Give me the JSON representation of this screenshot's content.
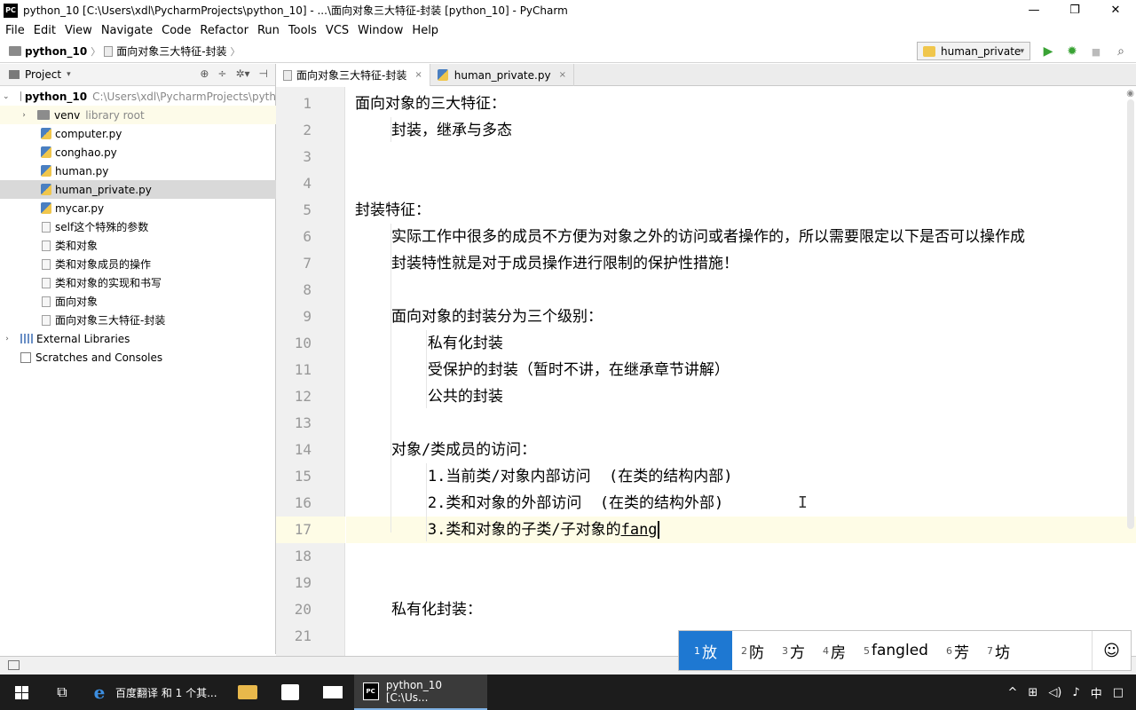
{
  "window": {
    "title": "python_10 [C:\\Users\\xdl\\PycharmProjects\\python_10] - ...\\面向对象三大特征-封装 [python_10] - PyCharm",
    "logo": "PC",
    "minimize": "—",
    "restore": "❐",
    "close": "✕"
  },
  "menu": [
    "File",
    "Edit",
    "View",
    "Navigate",
    "Code",
    "Refactor",
    "Run",
    "Tools",
    "VCS",
    "Window",
    "Help"
  ],
  "breadcrumb": {
    "project": "python_10",
    "file": "面向对象三大特征-封装",
    "sep": "〉"
  },
  "run_config": {
    "name": "human_private",
    "dropdown": "▾",
    "run_icon": "▶",
    "debug_icon": "✹",
    "stop_icon": "■",
    "search_icon": "⌕"
  },
  "project_panel": {
    "title": "Project",
    "dropdown": "▾",
    "tools": [
      "⊕",
      "÷",
      "✲▾",
      "⊣"
    ],
    "root_name": "python_10",
    "root_path": "C:\\Users\\xdl\\PycharmProjects\\pyth",
    "venv": "venv",
    "venv_note": "library root",
    "files": [
      "computer.py",
      "conghao.py",
      "human.py",
      "human_private.py",
      "mycar.py",
      "self这个特殊的参数",
      "类和对象",
      "类和对象成员的操作",
      "类和对象的实现和书写",
      "面向对象",
      "面向对象三大特征-封装"
    ],
    "external": "External Libraries",
    "scratches": "Scratches and Consoles",
    "collapsed": "›",
    "expanded": "⌄"
  },
  "tabs": [
    {
      "label": "面向对象三大特征-封装",
      "close": "×"
    },
    {
      "label": "human_private.py",
      "close": "×"
    }
  ],
  "editor": {
    "line_numbers": [
      "1",
      "2",
      "3",
      "4",
      "5",
      "6",
      "7",
      "8",
      "9",
      "10",
      "11",
      "12",
      "13",
      "14",
      "15",
      "16",
      "17",
      "18",
      "19",
      "20",
      "21"
    ],
    "lines": [
      "面向对象的三大特征：",
      "    封装，继承与多态",
      "",
      "",
      "封装特征：",
      "    实际工作中很多的成员不方便为对象之外的访问或者操作的，所以需要限定以下是否可以操作成",
      "    封装特性就是对于成员操作进行限制的保护性措施！",
      "",
      "    面向对象的封装分为三个级别：",
      "        私有化封装",
      "        受保护的封装（暂时不讲，在继承章节讲解）",
      "        公共的封装",
      "",
      "    对象/类成员的访问：",
      "        1.当前类/对象内部访问  (在类的结构内部)",
      "        2.类和对象的外部访问  (在类的结构外部)",
      "        3.类和对象的子类/子对象的",
      "",
      "",
      "    私有化封装：",
      ""
    ],
    "typed_text": "fang",
    "ibeam": "I",
    "eye_icon": "◉"
  },
  "ime": {
    "candidates": [
      {
        "n": "1",
        "text": "放"
      },
      {
        "n": "2",
        "text": "防"
      },
      {
        "n": "3",
        "text": "方"
      },
      {
        "n": "4",
        "text": "房"
      },
      {
        "n": "5",
        "text": "fangled"
      },
      {
        "n": "6",
        "text": "芳"
      },
      {
        "n": "7",
        "text": "坊"
      }
    ],
    "emoji": "☺"
  },
  "taskbar": {
    "items": [
      {
        "label": "百度翻译 和 1 个其..."
      },
      {
        "label": "python_10 [C:\\Us..."
      }
    ],
    "task_view": "⧉",
    "pc_logo": "PC",
    "tray": [
      "^",
      "⊞",
      "◁)",
      "♪",
      "中",
      "□"
    ]
  },
  "colors": {
    "ime_selected": "#1e78d2",
    "run_green": "#3aa335",
    "current_line": "#fefce6"
  }
}
